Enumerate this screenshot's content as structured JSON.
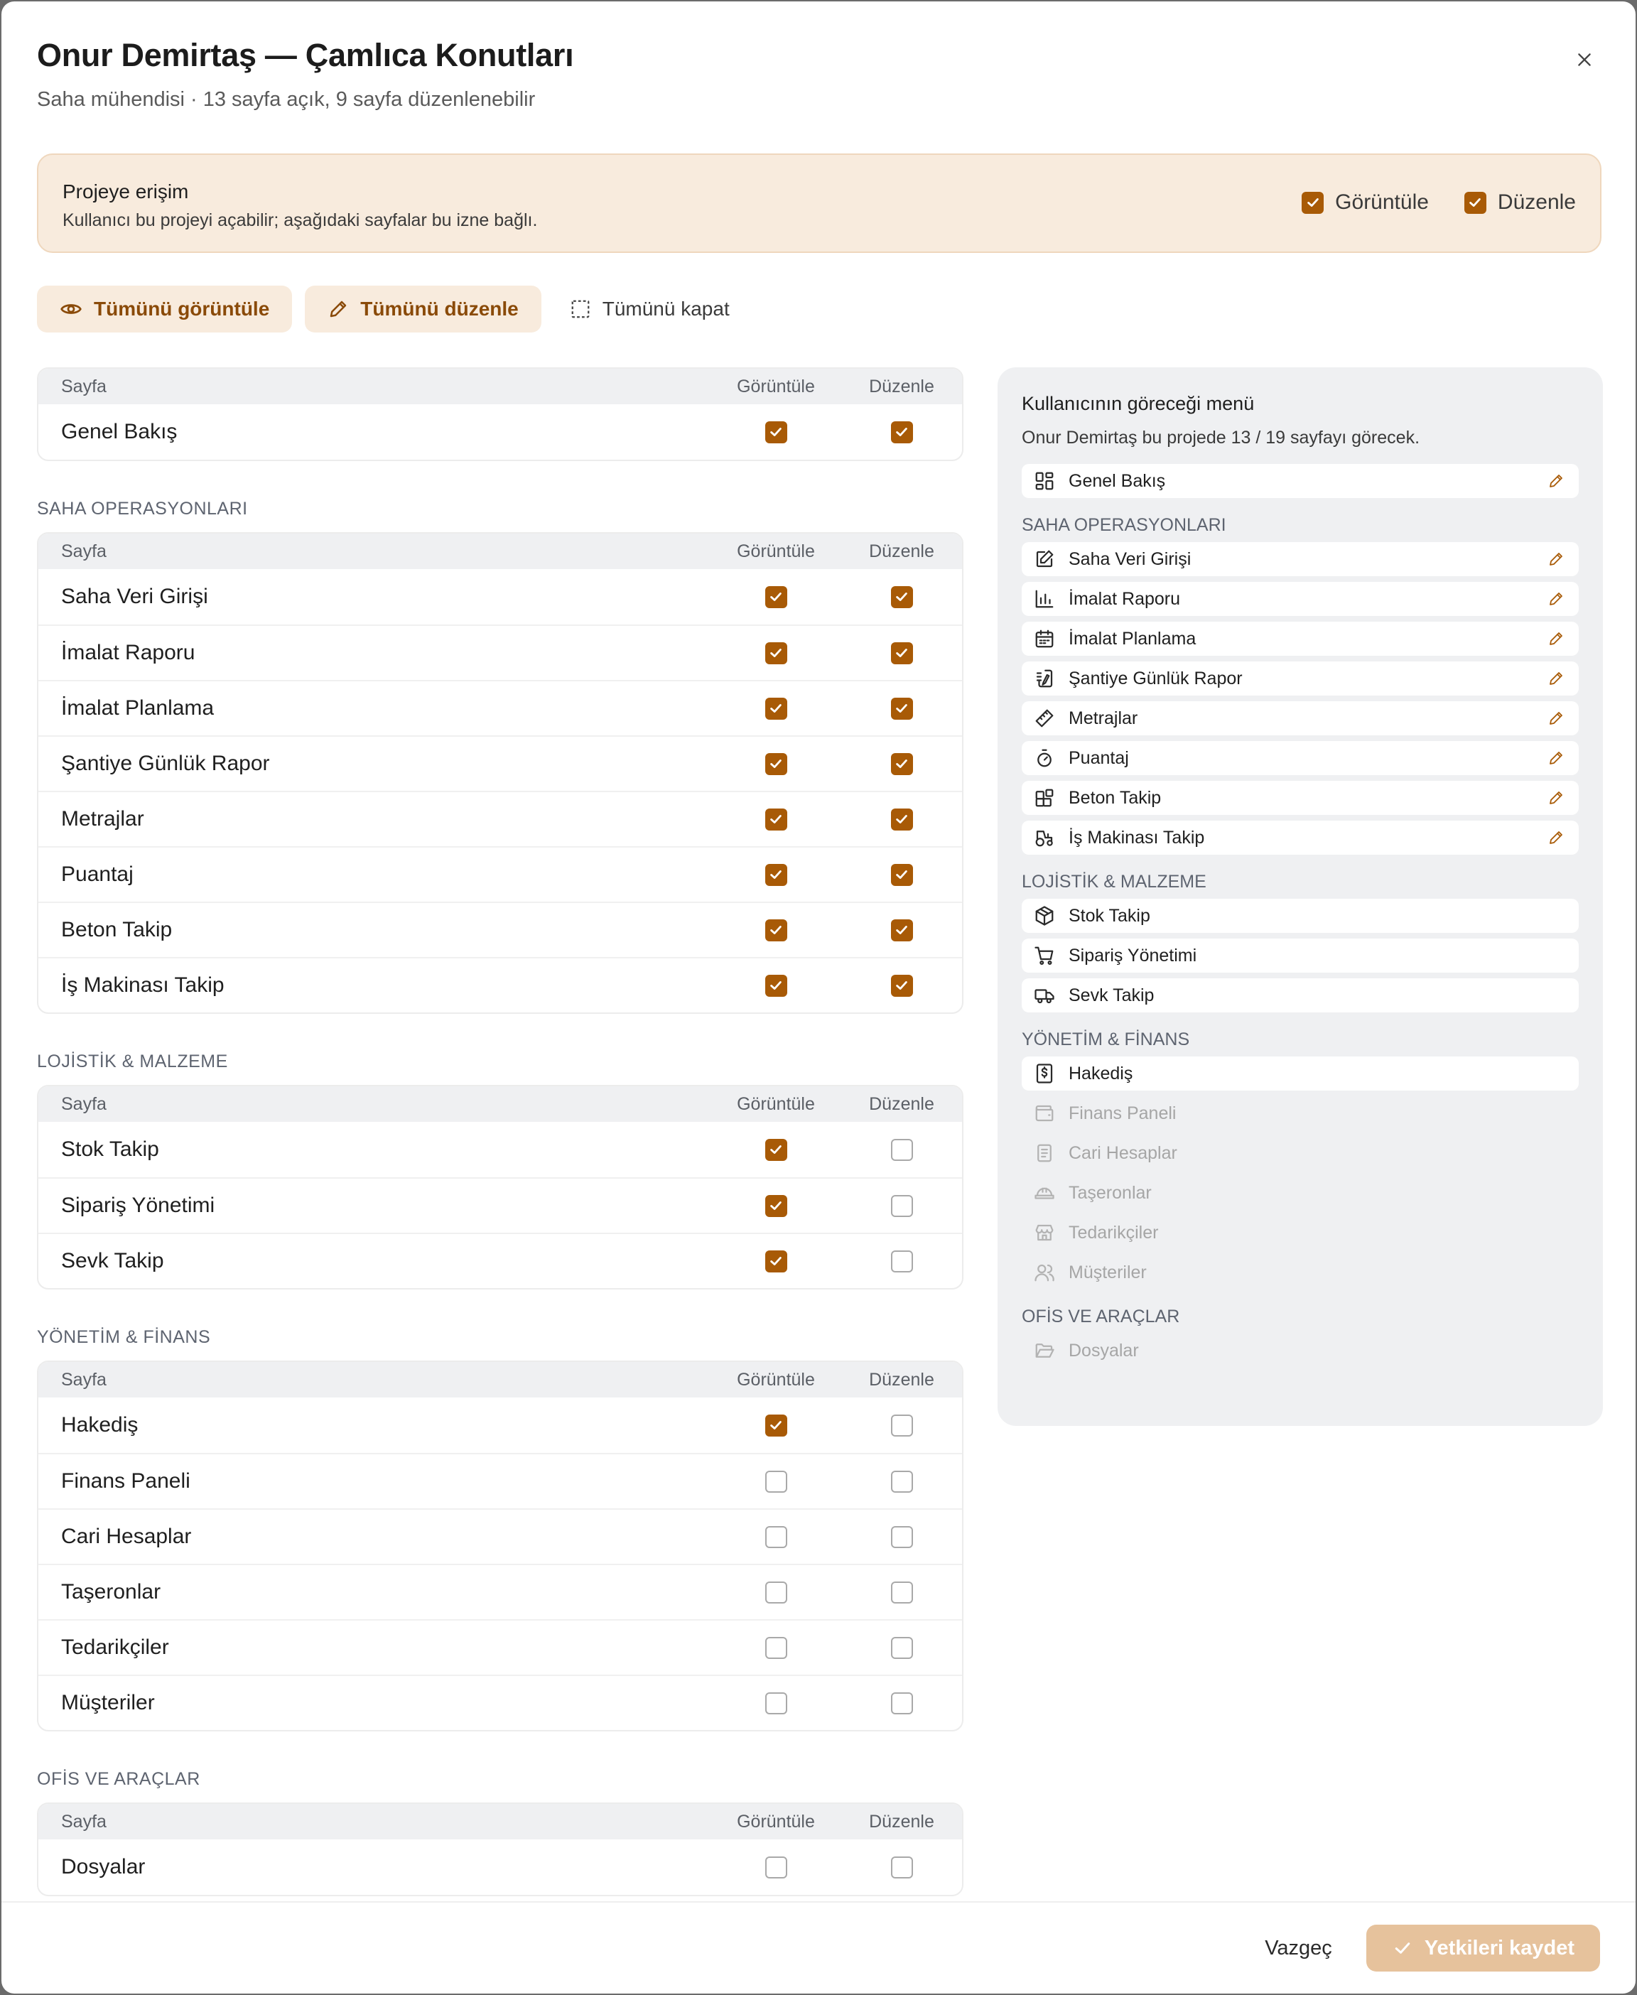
{
  "header": {
    "title": "Onur Demirtaş — Çamlıca Konutları",
    "subtitle": "Saha mühendisi · 13 sayfa açık, 9 sayfa düzenlenebilir"
  },
  "access": {
    "title": "Projeye erişim",
    "description": "Kullanıcı bu projeyi açabilir; aşağıdaki sayfalar bu izne bağlı.",
    "view_label": "Görüntüle",
    "edit_label": "Düzenle"
  },
  "toolbar": {
    "view_all": "Tümünü görüntüle",
    "edit_all": "Tümünü düzenle",
    "close_all": "Tümünü kapat"
  },
  "table_headers": {
    "page": "Sayfa",
    "view": "Görüntüle",
    "edit": "Düzenle"
  },
  "sections": [
    {
      "label": "",
      "rows": [
        {
          "name": "Genel Bakış",
          "view": true,
          "edit": true
        }
      ]
    },
    {
      "label": "SAHA OPERASYONLARI",
      "rows": [
        {
          "name": "Saha Veri Girişi",
          "view": true,
          "edit": true
        },
        {
          "name": "İmalat Raporu",
          "view": true,
          "edit": true
        },
        {
          "name": "İmalat Planlama",
          "view": true,
          "edit": true
        },
        {
          "name": "Şantiye Günlük Rapor",
          "view": true,
          "edit": true
        },
        {
          "name": "Metrajlar",
          "view": true,
          "edit": true
        },
        {
          "name": "Puantaj",
          "view": true,
          "edit": true
        },
        {
          "name": "Beton Takip",
          "view": true,
          "edit": true
        },
        {
          "name": "İş Makinası Takip",
          "view": true,
          "edit": true
        }
      ]
    },
    {
      "label": "LOJİSTİK & MALZEME",
      "rows": [
        {
          "name": "Stok Takip",
          "view": true,
          "edit": false
        },
        {
          "name": "Sipariş Yönetimi",
          "view": true,
          "edit": false
        },
        {
          "name": "Sevk Takip",
          "view": true,
          "edit": false
        }
      ]
    },
    {
      "label": "YÖNETİM & FİNANS",
      "rows": [
        {
          "name": "Hakediş",
          "view": true,
          "edit": false
        },
        {
          "name": "Finans Paneli",
          "view": false,
          "edit": false
        },
        {
          "name": "Cari Hesaplar",
          "view": false,
          "edit": false
        },
        {
          "name": "Taşeronlar",
          "view": false,
          "edit": false
        },
        {
          "name": "Tedarikçiler",
          "view": false,
          "edit": false
        },
        {
          "name": "Müşteriler",
          "view": false,
          "edit": false
        }
      ]
    },
    {
      "label": "OFİS VE ARAÇLAR",
      "rows": [
        {
          "name": "Dosyalar",
          "view": false,
          "edit": false
        }
      ]
    }
  ],
  "preview": {
    "title": "Kullanıcının göreceği menü",
    "description": "Onur Demirtaş bu projede 13 / 19 sayfayı görecek.",
    "groups": [
      {
        "label": "",
        "items": [
          {
            "name": "Genel Bakış",
            "icon": "dashboard-icon",
            "enabled": true,
            "editable": true
          }
        ]
      },
      {
        "label": "SAHA OPERASYONLARI",
        "items": [
          {
            "name": "Saha Veri Girişi",
            "icon": "edit-square-icon",
            "enabled": true,
            "editable": true
          },
          {
            "name": "İmalat Raporu",
            "icon": "bar-chart-icon",
            "enabled": true,
            "editable": true
          },
          {
            "name": "İmalat Planlama",
            "icon": "calendar-icon",
            "enabled": true,
            "editable": true
          },
          {
            "name": "Şantiye Günlük Rapor",
            "icon": "notebook-icon",
            "enabled": true,
            "editable": true
          },
          {
            "name": "Metrajlar",
            "icon": "ruler-icon",
            "enabled": true,
            "editable": true
          },
          {
            "name": "Puantaj",
            "icon": "stopwatch-icon",
            "enabled": true,
            "editable": true
          },
          {
            "name": "Beton Takip",
            "icon": "blocks-icon",
            "enabled": true,
            "editable": true
          },
          {
            "name": "İş Makinası Takip",
            "icon": "tractor-icon",
            "enabled": true,
            "editable": true
          }
        ]
      },
      {
        "label": "LOJİSTİK & MALZEME",
        "items": [
          {
            "name": "Stok Takip",
            "icon": "package-icon",
            "enabled": true,
            "editable": false
          },
          {
            "name": "Sipariş Yönetimi",
            "icon": "cart-icon",
            "enabled": true,
            "editable": false
          },
          {
            "name": "Sevk Takip",
            "icon": "truck-icon",
            "enabled": true,
            "editable": false
          }
        ]
      },
      {
        "label": "YÖNETİM & FİNANS",
        "items": [
          {
            "name": "Hakediş",
            "icon": "receipt-dollar-icon",
            "enabled": true,
            "editable": false
          },
          {
            "name": "Finans Paneli",
            "icon": "wallet-icon",
            "enabled": false,
            "editable": false
          },
          {
            "name": "Cari Hesaplar",
            "icon": "document-icon",
            "enabled": false,
            "editable": false
          },
          {
            "name": "Taşeronlar",
            "icon": "hard-hat-icon",
            "enabled": false,
            "editable": false
          },
          {
            "name": "Tedarikçiler",
            "icon": "store-icon",
            "enabled": false,
            "editable": false
          },
          {
            "name": "Müşteriler",
            "icon": "users-icon",
            "enabled": false,
            "editable": false
          }
        ]
      },
      {
        "label": "OFİS VE ARAÇLAR",
        "items": [
          {
            "name": "Dosyalar",
            "icon": "folder-icon",
            "enabled": false,
            "editable": false
          }
        ]
      }
    ]
  },
  "footer": {
    "cancel": "Vazgeç",
    "save": "Yetkileri kaydet"
  },
  "colors": {
    "accent": "#a85a06",
    "accent_soft": "#f8ebdd",
    "save_disabled": "#e6c29c"
  }
}
